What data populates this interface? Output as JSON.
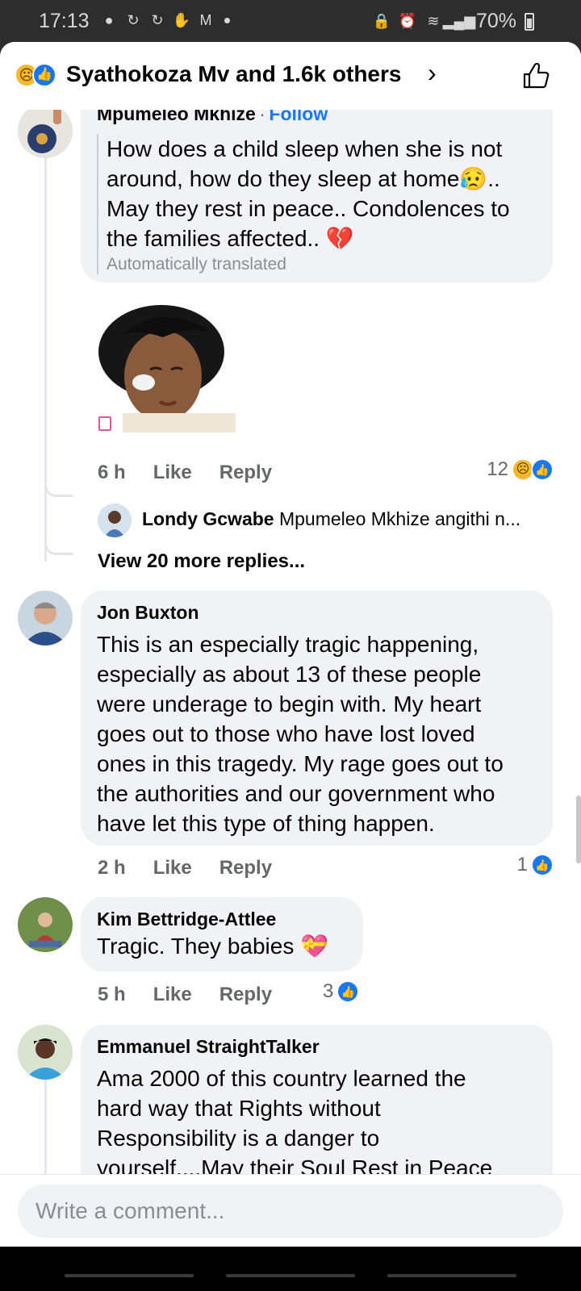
{
  "status_bar": {
    "time": "17:13",
    "battery": "70%",
    "left_icons": [
      "notification-icon",
      "sync-icon",
      "sync-icon",
      "hand-icon",
      "gmail-icon"
    ],
    "right_icons": [
      "lock-icon",
      "alarm-icon",
      "wifi-icon",
      "signal-icon",
      "battery-icon"
    ]
  },
  "header": {
    "title": "Syathokoza Mv and 1.6k others",
    "reactions": [
      "sad-reaction",
      "like-reaction"
    ]
  },
  "comments": [
    {
      "author": "Mpumeleo Mkhize",
      "follow_label": "Follow",
      "separator": "·",
      "text_lines": [
        "How does a child sleep when she is not",
        "around, how do they sleep at home😥..",
        "May they rest in peace.. Condolences to",
        "the families affected.. 💔"
      ],
      "translated_label": "Automatically translated",
      "time": "6 h",
      "like_label": "Like",
      "reply_label": "Reply",
      "reaction_count": "12",
      "replies": [
        {
          "author": "Londy Gcwabe",
          "text": "Mpumeleo Mkhize angithi n..."
        }
      ],
      "view_more_label": "View 20 more replies..."
    },
    {
      "author": "Jon Buxton",
      "text_lines": [
        "This is an especially tragic happening,",
        "especially as about 13 of these people",
        "were underage to begin with.  My heart",
        "goes out to those who have lost loved",
        "ones in this tragedy.  My rage goes out to",
        "the authorities and our government who",
        "have let this type of thing happen."
      ],
      "time": "2 h",
      "like_label": "Like",
      "reply_label": "Reply",
      "reaction_count": "1"
    },
    {
      "author": "Kim Bettridge-Attlee",
      "text_lines": [
        "Tragic. They babies 💝"
      ],
      "time": "5 h",
      "like_label": "Like",
      "reply_label": "Reply",
      "reaction_count": "3"
    },
    {
      "author": "Emmanuel StraightTalker",
      "text_lines": [
        "Ama 2000 of this country learned the",
        "hard way that Rights without",
        "Responsibility is a danger to",
        "yourself....May their Soul Rest in Peace"
      ]
    }
  ],
  "composer": {
    "placeholder": "Write a comment..."
  },
  "colors": {
    "accent": "#1877f2",
    "bubble": "#f0f2f5",
    "secondary_text": "#65676b"
  }
}
